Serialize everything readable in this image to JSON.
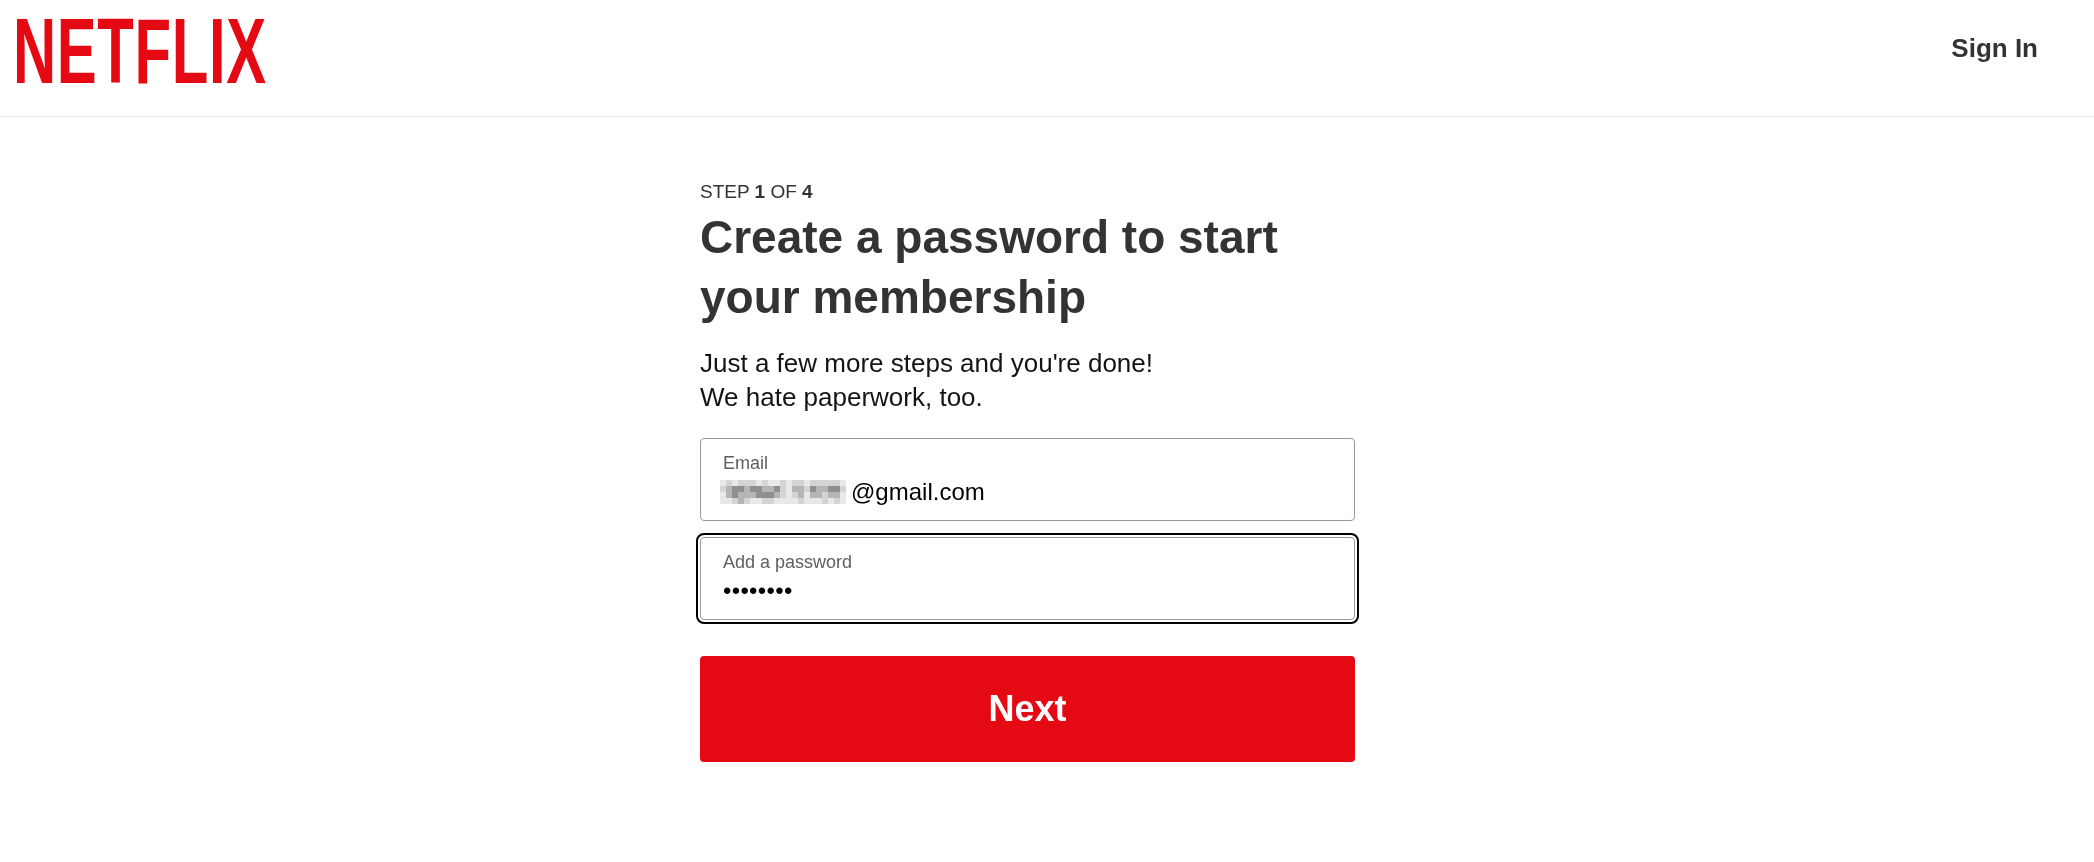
{
  "header": {
    "logo": "NETFLIX",
    "sign_in": "Sign In"
  },
  "step": "STEP **1** OF **4**",
  "title": "Create a password to start your membership",
  "subtitle_lines": [
    "Just a few more steps and you're done!",
    "We hate paperwork, too."
  ],
  "fields": [
    {
      "kind": "email",
      "label": "Email",
      "value": "@gmail.com",
      "redacted": true,
      "focused": false
    },
    {
      "kind": "password",
      "label": "Add a password",
      "value": "••••••••",
      "redacted": false,
      "focused": true
    }
  ],
  "button": "Next"
}
